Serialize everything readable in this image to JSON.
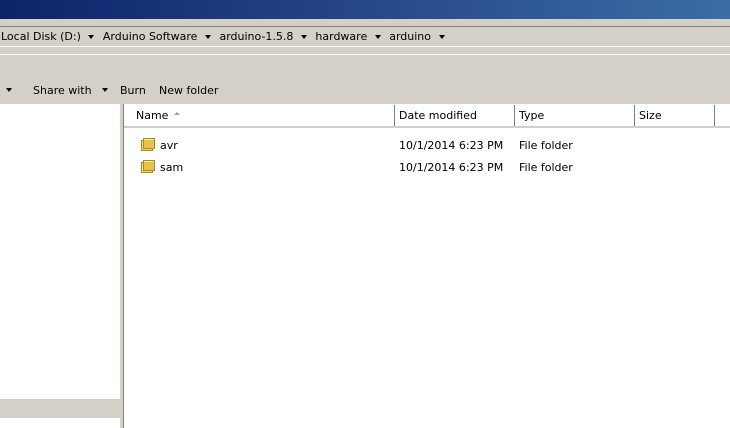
{
  "address": {
    "crumbs": [
      {
        "label": "Local Disk (D:)"
      },
      {
        "label": "Arduino Software"
      },
      {
        "label": "arduino-1.5.8"
      },
      {
        "label": "hardware"
      },
      {
        "label": "arduino"
      }
    ]
  },
  "toolbar": {
    "share_label": "Share with",
    "burn_label": "Burn",
    "new_folder_label": "New folder"
  },
  "columns": {
    "name": "Name",
    "date": "Date modified",
    "type": "Type",
    "size": "Size"
  },
  "files": [
    {
      "name": "avr",
      "date": "10/1/2014 6:23 PM",
      "type": "File folder",
      "size": "",
      "icon": "folder-icon"
    },
    {
      "name": "sam",
      "date": "10/1/2014 6:23 PM",
      "type": "File folder",
      "size": "",
      "icon": "folder-icon"
    }
  ],
  "colors": {
    "title_bar": "#0a246a",
    "chrome": "#d4d0c8",
    "folder": "#e8c34a"
  }
}
